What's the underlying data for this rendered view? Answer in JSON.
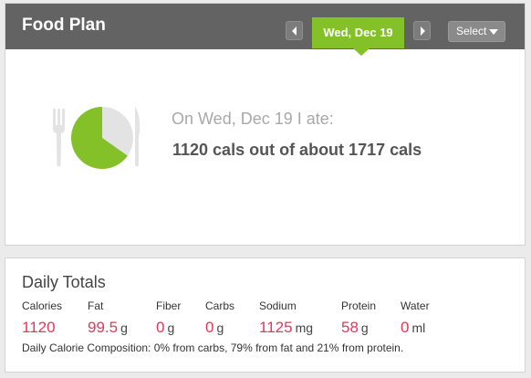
{
  "header": {
    "title": "Food Plan",
    "date_label": "Wed, Dec 19",
    "select_label": "Select",
    "prev_icon": "chevron-left-icon",
    "next_icon": "chevron-right-icon"
  },
  "summary": {
    "ate_text": "On Wed, Dec 19 I ate:",
    "cals_text": "1120 cals out of about 1717 cals",
    "calories_eaten": 1120,
    "calories_target": 1717,
    "pie_color": "#84c028",
    "plate_color": "#e3e3e3"
  },
  "totals": {
    "title": "Daily Totals",
    "columns": [
      {
        "label": "Calories",
        "value": "1120",
        "unit": ""
      },
      {
        "label": "Fat",
        "value": "99.5",
        "unit": "g"
      },
      {
        "label": "Fiber",
        "value": "0",
        "unit": "g"
      },
      {
        "label": "Carbs",
        "value": "0",
        "unit": "g"
      },
      {
        "label": "Sodium",
        "value": "1125",
        "unit": "mg"
      },
      {
        "label": "Protein",
        "value": "58",
        "unit": "g"
      },
      {
        "label": "Water",
        "value": "0",
        "unit": "ml"
      }
    ],
    "composition": "Daily Calorie Composition: 0% from carbs, 79% from fat and 21% from protein."
  },
  "colors": {
    "header_bg": "#636363",
    "accent_green": "#84c028",
    "value_red": "#e8355a"
  }
}
